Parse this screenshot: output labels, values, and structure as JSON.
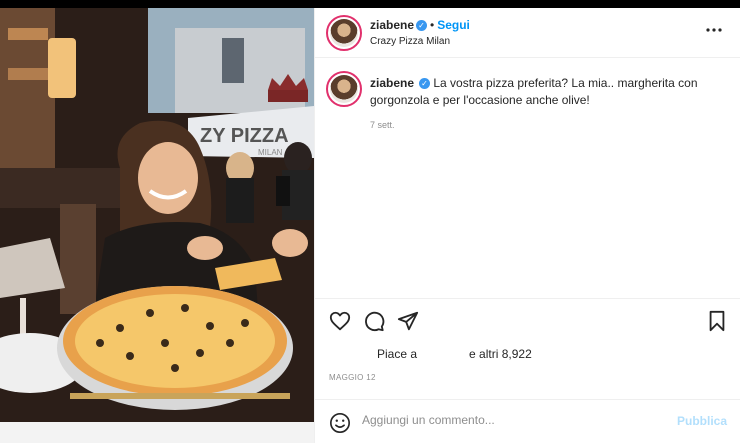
{
  "post": {
    "username": "ziabene",
    "verified_mark": "✓",
    "separator": "•",
    "follow_label": "Segui",
    "location": "Crazy Pizza Milan",
    "more_icon": "more-dots-icon",
    "caption_text": "La vostra pizza preferita? La mia.. margherita con gorgonzola e per l'occasione anche olive!",
    "time_ago": "7 sett.",
    "likes_prefix": "Piace a",
    "likes_suffix": "e altri 8,922",
    "date": "MAGGIO 12",
    "photo_sign_text": "ZY PIZZA",
    "photo_sign_sub": "MILAN"
  },
  "actions": {
    "icons": [
      "heart-icon",
      "comment-icon",
      "share-icon",
      "bookmark-icon"
    ]
  },
  "comment": {
    "placeholder": "Aggiungi un commento...",
    "publish_label": "Pubblica",
    "emoji_icon": "emoji-icon"
  },
  "colors": {
    "accent": "#0095f6",
    "publish_disabled": "#b2dffc",
    "text": "#262626",
    "muted": "#8e8e8e"
  }
}
